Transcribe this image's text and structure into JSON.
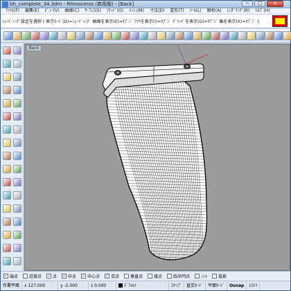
{
  "window": {
    "title": "bh_complete_34.3dm - Rhinoceros (商用版) - [Back]",
    "min_glyph": "─",
    "max_glyph": "□",
    "close_glyph": "✕"
  },
  "menu": [
    {
      "label": "ﾌｧｲﾙ(F)"
    },
    {
      "label": "編集(E)"
    },
    {
      "label": "ﾋﾞｭｰ(V)"
    },
    {
      "label": "曲線(C)"
    },
    {
      "label": "ｻｰﾌｪｽ(S)"
    },
    {
      "label": "ｿﾘｯﾄﾞ(O)"
    },
    {
      "label": "ﾒｯｼｭ(M)"
    },
    {
      "label": "寸法(D)"
    },
    {
      "label": "変形(T)"
    },
    {
      "label": "ﾂｰﾙ(L)"
    },
    {
      "label": "解析(A)"
    },
    {
      "label": "ﾚﾝﾀﾞﾘﾝｸﾞ(R)"
    },
    {
      "label": "ﾍﾙﾌﾟ(H)"
    }
  ],
  "command": {
    "prompt": "ｼｪｰﾃﾞｨﾝｸﾞ設定を選択 ( 表示ﾓｰﾄﾞ(D)=ｼｪｰﾃﾞｨﾝｸﾞ 曲線を表示(E)=ｵﾌﾞｼﾞ ﾜｲﾔを表示(I)=ｵﾌﾞｼﾞ ｸﾞﾘｯﾄﾞを表示(G)=ｵﾌﾞｼﾞ 軸を表示(X)=ｵﾌﾞｼﾞ ):",
    "swatch_outer": "#e00000",
    "swatch_inner": "#ffee00"
  },
  "viewport": {
    "label": "Back",
    "background": "#9c9c9c",
    "x_axis_color": "#c83030",
    "z_axis_color": "#6a58a8"
  },
  "osnap": [
    {
      "label": "端点",
      "checked": true
    },
    {
      "label": "近接点",
      "checked": false
    },
    {
      "label": "点",
      "checked": true
    },
    {
      "label": "中点",
      "checked": true
    },
    {
      "label": "中心点",
      "checked": true
    },
    {
      "label": "交点",
      "checked": true
    },
    {
      "label": "垂直点",
      "checked": false
    },
    {
      "label": "接点",
      "checked": false
    },
    {
      "label": "四半円点",
      "checked": false
    },
    {
      "label": "ﾉｯﾄ",
      "checked": false
    },
    {
      "label": "投影",
      "checked": false
    }
  ],
  "status": {
    "cplane": "作業平面",
    "x": "x 127.000",
    "y": "y -2.000",
    "z": "z 0.000",
    "layer": "ﾃﾞﾌｫﾙﾄ",
    "snap": "ｽﾅｯﾌﾟ",
    "ortho": "直交ﾓｰﾄﾞ",
    "planar": "平面ﾓｰﾄﾞ",
    "osnap": "Osnap",
    "history": "ﾋｽﾄﾘ"
  },
  "icons": {
    "top_toolbar": [
      "new-file-icon",
      "open-file-icon",
      "save-icon",
      "print-icon",
      "import-icon",
      "cut-icon",
      "copy-icon",
      "paste-icon",
      "undo-icon",
      "redo-icon",
      "pan-icon",
      "rotate-view-icon",
      "zoom-icon",
      "zoom-window-icon",
      "zoom-extents-icon",
      "zoom-selected-icon",
      "undo-view-icon",
      "four-views-icon",
      "grid-icon",
      "layer-icon",
      "properties-icon",
      "wireframe-icon",
      "shaded-icon",
      "rendered-icon",
      "sphere-icon",
      "gradient-icon",
      "light-icon",
      "render-icon",
      "ball-icon",
      "material-icon",
      "environment-icon",
      "help-icon"
    ],
    "left_toolbar": [
      "select-arrow-icon",
      "point-icon",
      "polyline-icon",
      "curve-icon",
      "circle-icon",
      "arc-icon",
      "ellipse-icon",
      "rectangle-icon",
      "polygon-icon",
      "freeform-icon",
      "surface-icon",
      "extrude-icon",
      "box-icon",
      "sphere-solid-icon",
      "cylinder-icon",
      "mesh-icon",
      "boolean-icon",
      "fillet-icon",
      "offset-icon",
      "trim-icon",
      "split-icon",
      "join-icon",
      "explode-icon",
      "move-icon",
      "copy-object-icon",
      "rotate-object-icon",
      "scale-icon",
      "mirror-icon",
      "array-icon",
      "dimension-icon",
      "text-icon",
      "hatch-icon",
      "analyze-icon",
      "render-object-icon"
    ]
  }
}
